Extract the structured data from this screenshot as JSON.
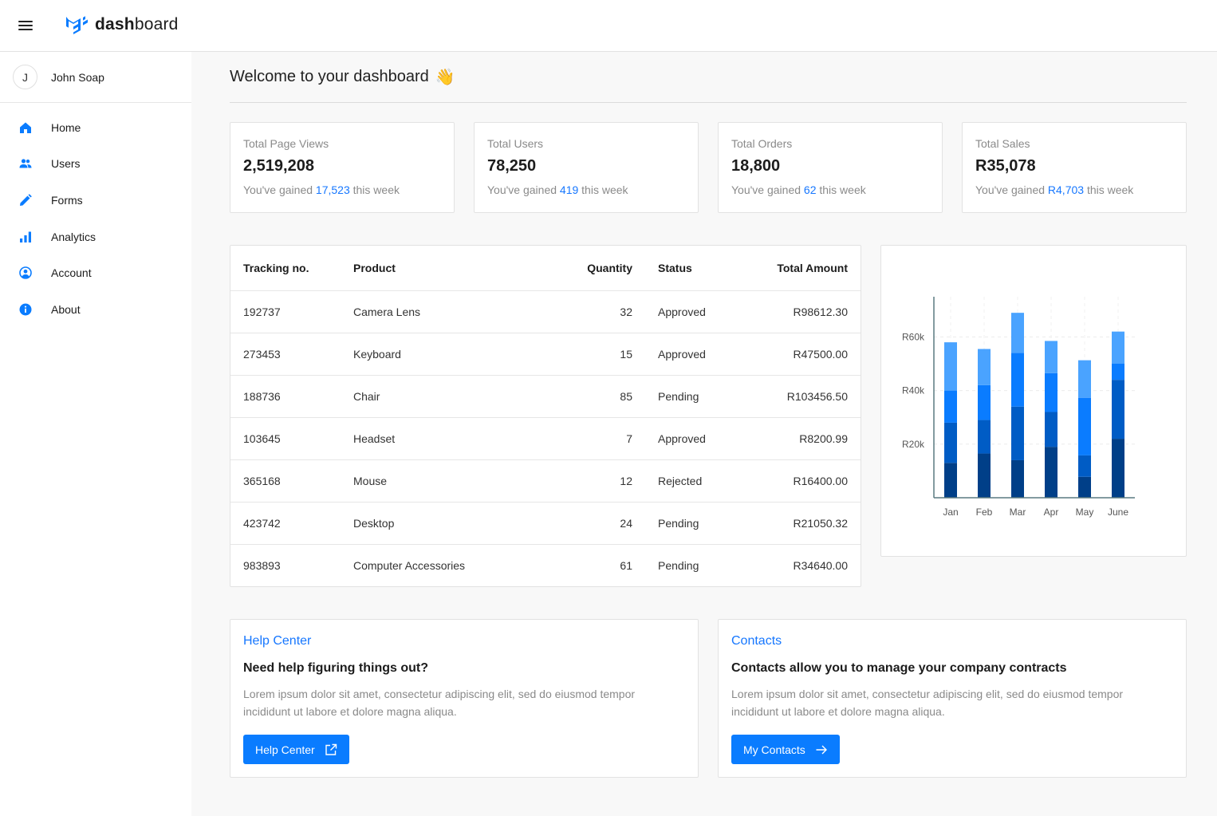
{
  "header": {
    "brand_bold": "dash",
    "brand_rest": "board",
    "menu_icon": "hamburger-menu-icon",
    "logo_icon": "mui-logo-icon"
  },
  "sidebar": {
    "user": {
      "initial": "J",
      "name": "John Soap"
    },
    "items": [
      {
        "label": "Home",
        "icon": "home-icon"
      },
      {
        "label": "Users",
        "icon": "users-icon"
      },
      {
        "label": "Forms",
        "icon": "pencil-icon"
      },
      {
        "label": "Analytics",
        "icon": "bar-chart-icon"
      },
      {
        "label": "Account",
        "icon": "account-circle-icon"
      },
      {
        "label": "About",
        "icon": "info-icon"
      }
    ]
  },
  "main": {
    "welcome": "Welcome to your dashboard",
    "welcome_emoji": "👋",
    "stats": [
      {
        "title": "Total Page Views",
        "value": "2,519,208",
        "prefix": "You've gained",
        "gain": "17,523",
        "suffix": "this week"
      },
      {
        "title": "Total Users",
        "value": "78,250",
        "prefix": "You've gained",
        "gain": "419",
        "suffix": "this week"
      },
      {
        "title": "Total Orders",
        "value": "18,800",
        "prefix": "You've gained",
        "gain": "62",
        "suffix": "this week"
      },
      {
        "title": "Total Sales",
        "value": "R35,078",
        "prefix": "You've gained",
        "gain": "R4,703",
        "suffix": "this week"
      }
    ],
    "table": {
      "headers": [
        "Tracking no.",
        "Product",
        "Quantity",
        "Status",
        "Total Amount"
      ],
      "rows": [
        [
          "192737",
          "Camera Lens",
          "32",
          "Approved",
          "R98612.30"
        ],
        [
          "273453",
          "Keyboard",
          "15",
          "Approved",
          "R47500.00"
        ],
        [
          "188736",
          "Chair",
          "85",
          "Pending",
          "R103456.50"
        ],
        [
          "103645",
          "Headset",
          "7",
          "Approved",
          "R8200.99"
        ],
        [
          "365168",
          "Mouse",
          "12",
          "Rejected",
          "R16400.00"
        ],
        [
          "423742",
          "Desktop",
          "24",
          "Pending",
          "R21050.32"
        ],
        [
          "983893",
          "Computer Accessories",
          "61",
          "Pending",
          "R34640.00"
        ]
      ]
    },
    "help": {
      "kicker": "Help Center",
      "heading": "Need help figuring things out?",
      "text": "Lorem ipsum dolor sit amet, consectetur adipiscing elit, sed do eiusmod tempor incididunt ut labore et dolore magna aliqua.",
      "button": "Help Center",
      "button_icon": "external-link-icon"
    },
    "contacts": {
      "kicker": "Contacts",
      "heading": "Contacts allow you to manage your company contracts",
      "text": "Lorem ipsum dolor sit amet, consectetur adipiscing elit, sed do eiusmod tempor incididunt ut labore et dolore magna aliqua.",
      "button": "My Contacts",
      "button_icon": "arrow-right-icon"
    }
  },
  "colors": {
    "accent": "#1677ff",
    "button": "#0a7cff",
    "bar_segments": [
      "#003f88",
      "#005cc5",
      "#0a7cff",
      "#4aa3ff"
    ]
  },
  "chart_data": {
    "type": "bar",
    "stacked": true,
    "categories": [
      "Jan",
      "Feb",
      "Mar",
      "Apr",
      "May",
      "June"
    ],
    "series": [
      {
        "values": [
          13000,
          16500,
          14000,
          19000,
          7800,
          22000
        ]
      },
      {
        "values": [
          15000,
          12500,
          20000,
          13000,
          8000,
          22000
        ]
      },
      {
        "values": [
          12000,
          13000,
          20000,
          14500,
          21500,
          6000
        ]
      },
      {
        "values": [
          18000,
          13500,
          15000,
          12000,
          14000,
          12000
        ]
      }
    ],
    "yticks": [
      "R20k",
      "R40k",
      "R60k"
    ],
    "ylim": [
      0,
      75000
    ],
    "grid": true,
    "xlabel": "",
    "ylabel": ""
  }
}
